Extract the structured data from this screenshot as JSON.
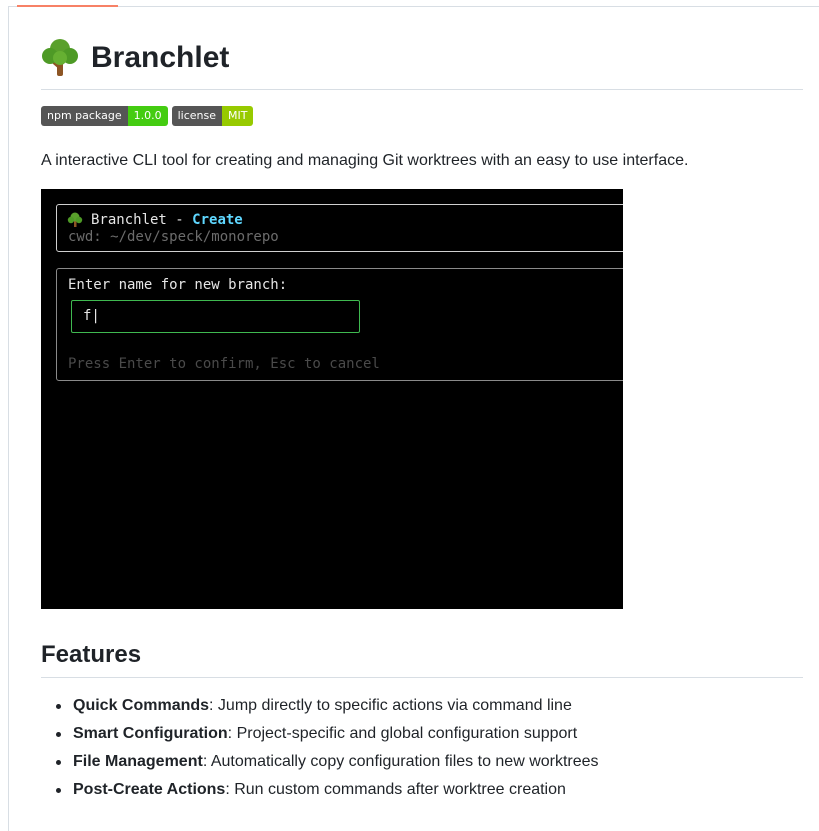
{
  "title": "Branchlet",
  "badges": [
    {
      "label": "npm package",
      "value": "1.0.0",
      "color": "#44cc11"
    },
    {
      "label": "license",
      "value": "MIT",
      "color": "#97ca00"
    }
  ],
  "intro": "A interactive CLI tool for creating and managing Git worktrees with an easy to use interface.",
  "terminal": {
    "app_name": "Branchlet - ",
    "mode": "Create",
    "cwd": "cwd: ~/dev/speck/monorepo",
    "prompt": "Enter name for new branch:",
    "input_value": "f|",
    "hint": "Press Enter to confirm, Esc to cancel"
  },
  "features": {
    "heading": "Features",
    "items": [
      {
        "name": "Quick Commands",
        "desc": ": Jump directly to specific actions via command line"
      },
      {
        "name": "Smart Configuration",
        "desc": ": Project-specific and global configuration support"
      },
      {
        "name": "File Management",
        "desc": ": Automatically copy configuration files to new worktrees"
      },
      {
        "name": "Post-Create Actions",
        "desc": ": Run custom commands after worktree creation"
      }
    ]
  },
  "colors": {
    "accent": "#f78166",
    "input_border": "#3fb950",
    "mode": "#5fd7ff"
  }
}
